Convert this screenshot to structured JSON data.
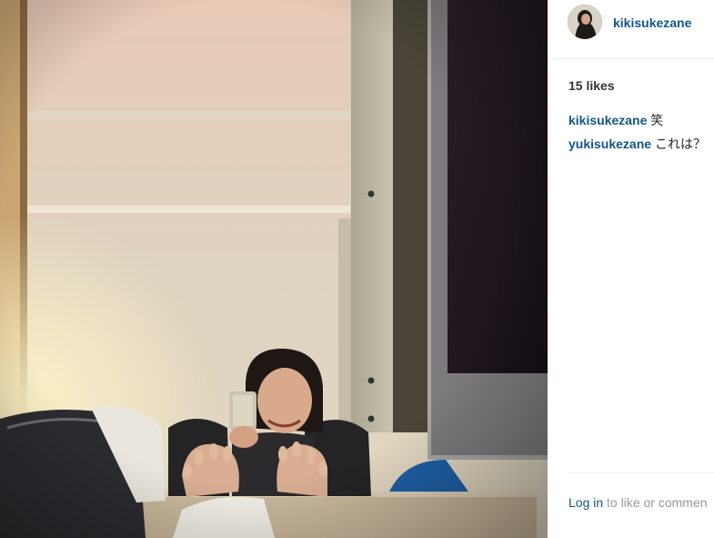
{
  "post": {
    "username": "kikisukezane",
    "likes_text": "15 likes",
    "comments": [
      {
        "author": "kikisukezane",
        "text": "笑"
      },
      {
        "author": "yukisukezane",
        "text": "これは？"
      }
    ],
    "login_link": "Log in",
    "login_rest": "to like or commen"
  },
  "colors": {
    "link": "#125688",
    "text": "#262626",
    "muted": "#999999"
  }
}
